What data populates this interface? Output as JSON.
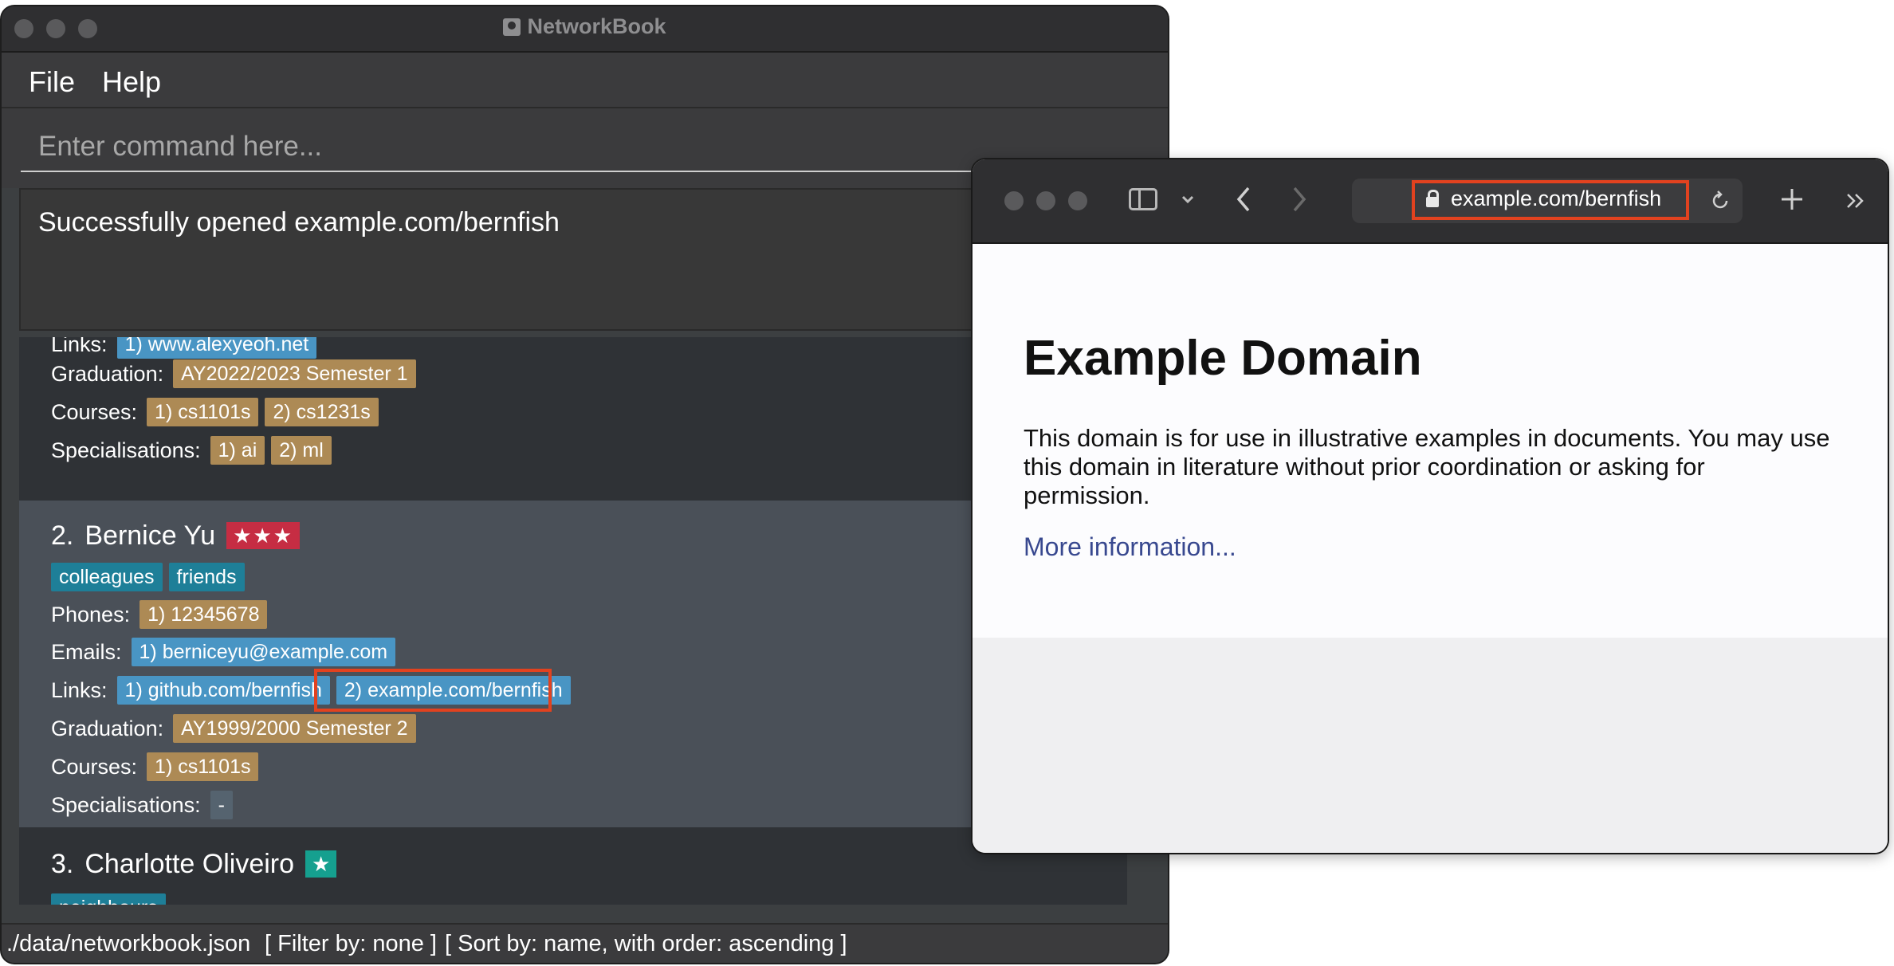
{
  "networkbook": {
    "title": "NetworkBook",
    "menu": [
      "File",
      "Help"
    ],
    "command_placeholder": "Enter command here...",
    "result_message": "Successfully opened example.com/bernfish",
    "contacts": [
      {
        "links_label": "Links:",
        "links": [
          "1) www.alexyeoh.net"
        ],
        "graduation_label": "Graduation:",
        "graduation": "AY2022/2023 Semester 1",
        "courses_label": "Courses:",
        "courses": [
          "1) cs1101s",
          "2) cs1231s"
        ],
        "specialisations_label": "Specialisations:",
        "specialisations": [
          "1) ai",
          "2) ml"
        ]
      },
      {
        "index": "2.",
        "name": "Bernice Yu",
        "stars": "★★★",
        "tags": [
          "colleagues",
          "friends"
        ],
        "phones_label": "Phones:",
        "phones": [
          "1) 12345678"
        ],
        "emails_label": "Emails:",
        "emails": [
          "1) berniceyu@example.com"
        ],
        "links_label": "Links:",
        "links": [
          "1) github.com/bernfish",
          "2) example.com/bernfish"
        ],
        "graduation_label": "Graduation:",
        "graduation": "AY1999/2000 Semester 2",
        "courses_label": "Courses:",
        "courses": [
          "1) cs1101s"
        ],
        "specialisations_label": "Specialisations:",
        "specialisations": [
          "-"
        ]
      },
      {
        "index": "3.",
        "name": "Charlotte Oliveiro",
        "stars": "★",
        "tags": [
          "neighbours"
        ]
      }
    ],
    "status_bar": {
      "file_path": "./data/networkbook.json",
      "filter": "[ Filter by: none ]",
      "sort": "[ Sort by: name, with order: ascending ]"
    }
  },
  "browser": {
    "url": "example.com/bernfish",
    "page_heading": "Example Domain",
    "page_paragraph": "This domain is for use in illustrative examples in documents. You may use this domain in literature without prior coordination or asking for permission.",
    "page_link": "More information..."
  },
  "colors": {
    "highlight": "#e2421f",
    "tag_blue": "#4995c4",
    "tag_brown": "#ad8a55",
    "tag_teal": "#1e7f98",
    "star_red": "#c62d43",
    "star_teal": "#15a08f"
  },
  "icons": [
    "app-icon",
    "sidebar-icon",
    "chevron-down-icon",
    "back-icon",
    "forward-icon",
    "lock-icon",
    "reload-icon",
    "new-tab-icon",
    "more-icon"
  ]
}
